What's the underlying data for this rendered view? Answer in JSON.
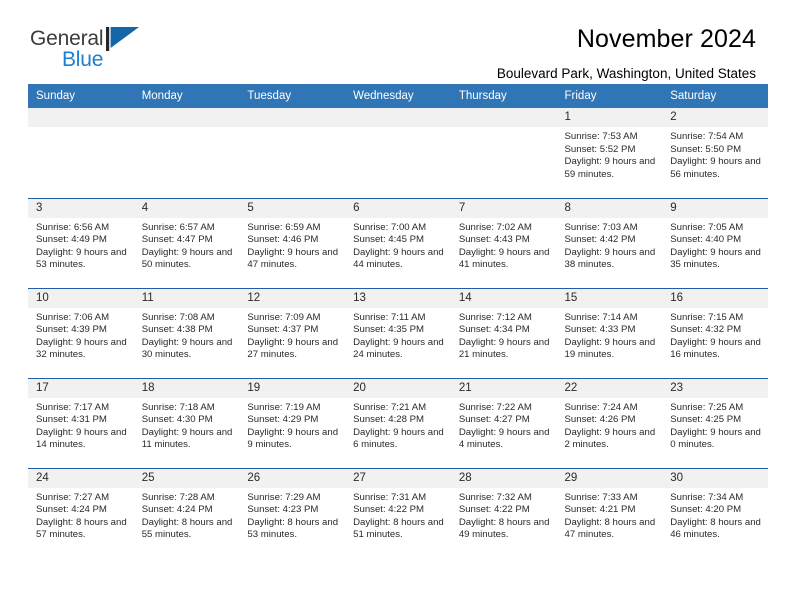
{
  "brand": {
    "name_part1": "General",
    "name_part2": "Blue",
    "mark_icon": "triangle-flag-icon",
    "color_text": "#3c3c3c",
    "color_accent": "#1b7fd4"
  },
  "header": {
    "title": "November 2024",
    "subtitle": "Boulevard Park, Washington, United States"
  },
  "theme": {
    "header_blue": "#3075b5",
    "row_border_blue": "#1f5fa9",
    "daynum_bg": "#f1f1f1"
  },
  "calendar": {
    "columns": [
      "Sunday",
      "Monday",
      "Tuesday",
      "Wednesday",
      "Thursday",
      "Friday",
      "Saturday"
    ],
    "weeks": [
      [
        {
          "day": "",
          "empty": true
        },
        {
          "day": "",
          "empty": true
        },
        {
          "day": "",
          "empty": true
        },
        {
          "day": "",
          "empty": true
        },
        {
          "day": "",
          "empty": true
        },
        {
          "day": "1",
          "sunrise": "Sunrise: 7:53 AM",
          "sunset": "Sunset: 5:52 PM",
          "daylight": "Daylight: 9 hours and 59 minutes."
        },
        {
          "day": "2",
          "sunrise": "Sunrise: 7:54 AM",
          "sunset": "Sunset: 5:50 PM",
          "daylight": "Daylight: 9 hours and 56 minutes."
        }
      ],
      [
        {
          "day": "3",
          "sunrise": "Sunrise: 6:56 AM",
          "sunset": "Sunset: 4:49 PM",
          "daylight": "Daylight: 9 hours and 53 minutes."
        },
        {
          "day": "4",
          "sunrise": "Sunrise: 6:57 AM",
          "sunset": "Sunset: 4:47 PM",
          "daylight": "Daylight: 9 hours and 50 minutes."
        },
        {
          "day": "5",
          "sunrise": "Sunrise: 6:59 AM",
          "sunset": "Sunset: 4:46 PM",
          "daylight": "Daylight: 9 hours and 47 minutes."
        },
        {
          "day": "6",
          "sunrise": "Sunrise: 7:00 AM",
          "sunset": "Sunset: 4:45 PM",
          "daylight": "Daylight: 9 hours and 44 minutes."
        },
        {
          "day": "7",
          "sunrise": "Sunrise: 7:02 AM",
          "sunset": "Sunset: 4:43 PM",
          "daylight": "Daylight: 9 hours and 41 minutes."
        },
        {
          "day": "8",
          "sunrise": "Sunrise: 7:03 AM",
          "sunset": "Sunset: 4:42 PM",
          "daylight": "Daylight: 9 hours and 38 minutes."
        },
        {
          "day": "9",
          "sunrise": "Sunrise: 7:05 AM",
          "sunset": "Sunset: 4:40 PM",
          "daylight": "Daylight: 9 hours and 35 minutes."
        }
      ],
      [
        {
          "day": "10",
          "sunrise": "Sunrise: 7:06 AM",
          "sunset": "Sunset: 4:39 PM",
          "daylight": "Daylight: 9 hours and 32 minutes."
        },
        {
          "day": "11",
          "sunrise": "Sunrise: 7:08 AM",
          "sunset": "Sunset: 4:38 PM",
          "daylight": "Daylight: 9 hours and 30 minutes."
        },
        {
          "day": "12",
          "sunrise": "Sunrise: 7:09 AM",
          "sunset": "Sunset: 4:37 PM",
          "daylight": "Daylight: 9 hours and 27 minutes."
        },
        {
          "day": "13",
          "sunrise": "Sunrise: 7:11 AM",
          "sunset": "Sunset: 4:35 PM",
          "daylight": "Daylight: 9 hours and 24 minutes."
        },
        {
          "day": "14",
          "sunrise": "Sunrise: 7:12 AM",
          "sunset": "Sunset: 4:34 PM",
          "daylight": "Daylight: 9 hours and 21 minutes."
        },
        {
          "day": "15",
          "sunrise": "Sunrise: 7:14 AM",
          "sunset": "Sunset: 4:33 PM",
          "daylight": "Daylight: 9 hours and 19 minutes."
        },
        {
          "day": "16",
          "sunrise": "Sunrise: 7:15 AM",
          "sunset": "Sunset: 4:32 PM",
          "daylight": "Daylight: 9 hours and 16 minutes."
        }
      ],
      [
        {
          "day": "17",
          "sunrise": "Sunrise: 7:17 AM",
          "sunset": "Sunset: 4:31 PM",
          "daylight": "Daylight: 9 hours and 14 minutes."
        },
        {
          "day": "18",
          "sunrise": "Sunrise: 7:18 AM",
          "sunset": "Sunset: 4:30 PM",
          "daylight": "Daylight: 9 hours and 11 minutes."
        },
        {
          "day": "19",
          "sunrise": "Sunrise: 7:19 AM",
          "sunset": "Sunset: 4:29 PM",
          "daylight": "Daylight: 9 hours and 9 minutes."
        },
        {
          "day": "20",
          "sunrise": "Sunrise: 7:21 AM",
          "sunset": "Sunset: 4:28 PM",
          "daylight": "Daylight: 9 hours and 6 minutes."
        },
        {
          "day": "21",
          "sunrise": "Sunrise: 7:22 AM",
          "sunset": "Sunset: 4:27 PM",
          "daylight": "Daylight: 9 hours and 4 minutes."
        },
        {
          "day": "22",
          "sunrise": "Sunrise: 7:24 AM",
          "sunset": "Sunset: 4:26 PM",
          "daylight": "Daylight: 9 hours and 2 minutes."
        },
        {
          "day": "23",
          "sunrise": "Sunrise: 7:25 AM",
          "sunset": "Sunset: 4:25 PM",
          "daylight": "Daylight: 9 hours and 0 minutes."
        }
      ],
      [
        {
          "day": "24",
          "sunrise": "Sunrise: 7:27 AM",
          "sunset": "Sunset: 4:24 PM",
          "daylight": "Daylight: 8 hours and 57 minutes."
        },
        {
          "day": "25",
          "sunrise": "Sunrise: 7:28 AM",
          "sunset": "Sunset: 4:24 PM",
          "daylight": "Daylight: 8 hours and 55 minutes."
        },
        {
          "day": "26",
          "sunrise": "Sunrise: 7:29 AM",
          "sunset": "Sunset: 4:23 PM",
          "daylight": "Daylight: 8 hours and 53 minutes."
        },
        {
          "day": "27",
          "sunrise": "Sunrise: 7:31 AM",
          "sunset": "Sunset: 4:22 PM",
          "daylight": "Daylight: 8 hours and 51 minutes."
        },
        {
          "day": "28",
          "sunrise": "Sunrise: 7:32 AM",
          "sunset": "Sunset: 4:22 PM",
          "daylight": "Daylight: 8 hours and 49 minutes."
        },
        {
          "day": "29",
          "sunrise": "Sunrise: 7:33 AM",
          "sunset": "Sunset: 4:21 PM",
          "daylight": "Daylight: 8 hours and 47 minutes."
        },
        {
          "day": "30",
          "sunrise": "Sunrise: 7:34 AM",
          "sunset": "Sunset: 4:20 PM",
          "daylight": "Daylight: 8 hours and 46 minutes."
        }
      ]
    ]
  }
}
